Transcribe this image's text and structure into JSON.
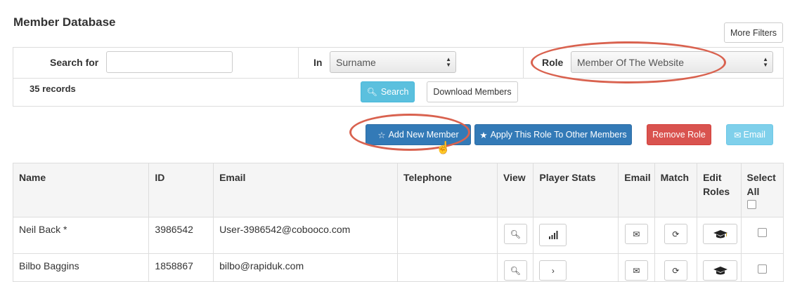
{
  "page": {
    "title": "Member Database"
  },
  "toolbar": {
    "more_filters_label": "More Filters"
  },
  "filters": {
    "search_label": "Search for",
    "search_value": "",
    "in_label": "In",
    "in_selected": "Surname",
    "role_label": "Role",
    "role_selected": "Member Of The Website",
    "records": "35 records",
    "search_button": "Search",
    "download_button": "Download Members"
  },
  "actions": {
    "add_new_member": "Add New Member",
    "apply_role": "Apply This Role To Other Members",
    "remove_role": "Remove Role",
    "email": "Email"
  },
  "table": {
    "headers": {
      "name": "Name",
      "id": "ID",
      "email": "Email",
      "telephone": "Telephone",
      "view": "View",
      "player_stats": "Player Stats",
      "email_action": "Email",
      "match": "Match",
      "edit_roles_1": "Edit",
      "edit_roles_2": "Roles",
      "select_all_1": "Select",
      "select_all_2": "All"
    },
    "rows": [
      {
        "name": "Neil Back *",
        "id": "3986542",
        "email": "User-3986542@cobooco.com",
        "telephone": ""
      },
      {
        "name": "Bilbo Baggins",
        "id": "1858867",
        "email": "bilbo@rapiduk.com",
        "telephone": ""
      }
    ]
  },
  "colors": {
    "highlight": "#d9624f",
    "primary": "#337ab7",
    "info": "#5bc0de",
    "danger": "#d9534f"
  }
}
